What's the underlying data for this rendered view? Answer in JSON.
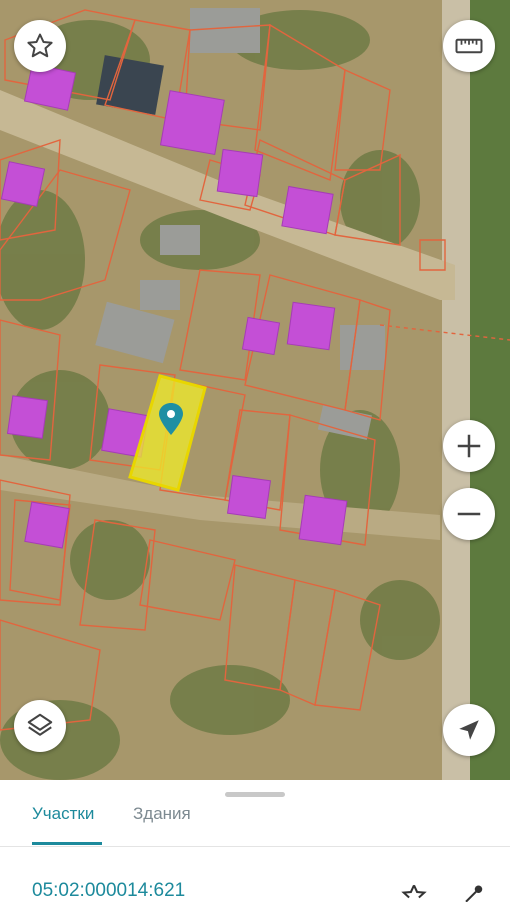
{
  "map": {
    "colors": {
      "parcel_border": "#e2653e",
      "building_fill": "#c44fd6",
      "selected_fill": "#f0ec2a",
      "selected_border": "#e8d600",
      "marker": "#1e8fa3"
    }
  },
  "controls": {
    "favorite_icon": "star-icon",
    "ruler_icon": "ruler-icon",
    "zoom_in_icon": "plus-icon",
    "zoom_out_icon": "minus-icon",
    "layers_icon": "layers-icon",
    "locate_icon": "navigation-arrow-icon"
  },
  "sheet": {
    "tabs": [
      {
        "label": "Участки",
        "active": true
      },
      {
        "label": "Здания",
        "active": false
      }
    ],
    "parcel_id": "05:02:000014:621",
    "accent": "#1d8a9c"
  }
}
